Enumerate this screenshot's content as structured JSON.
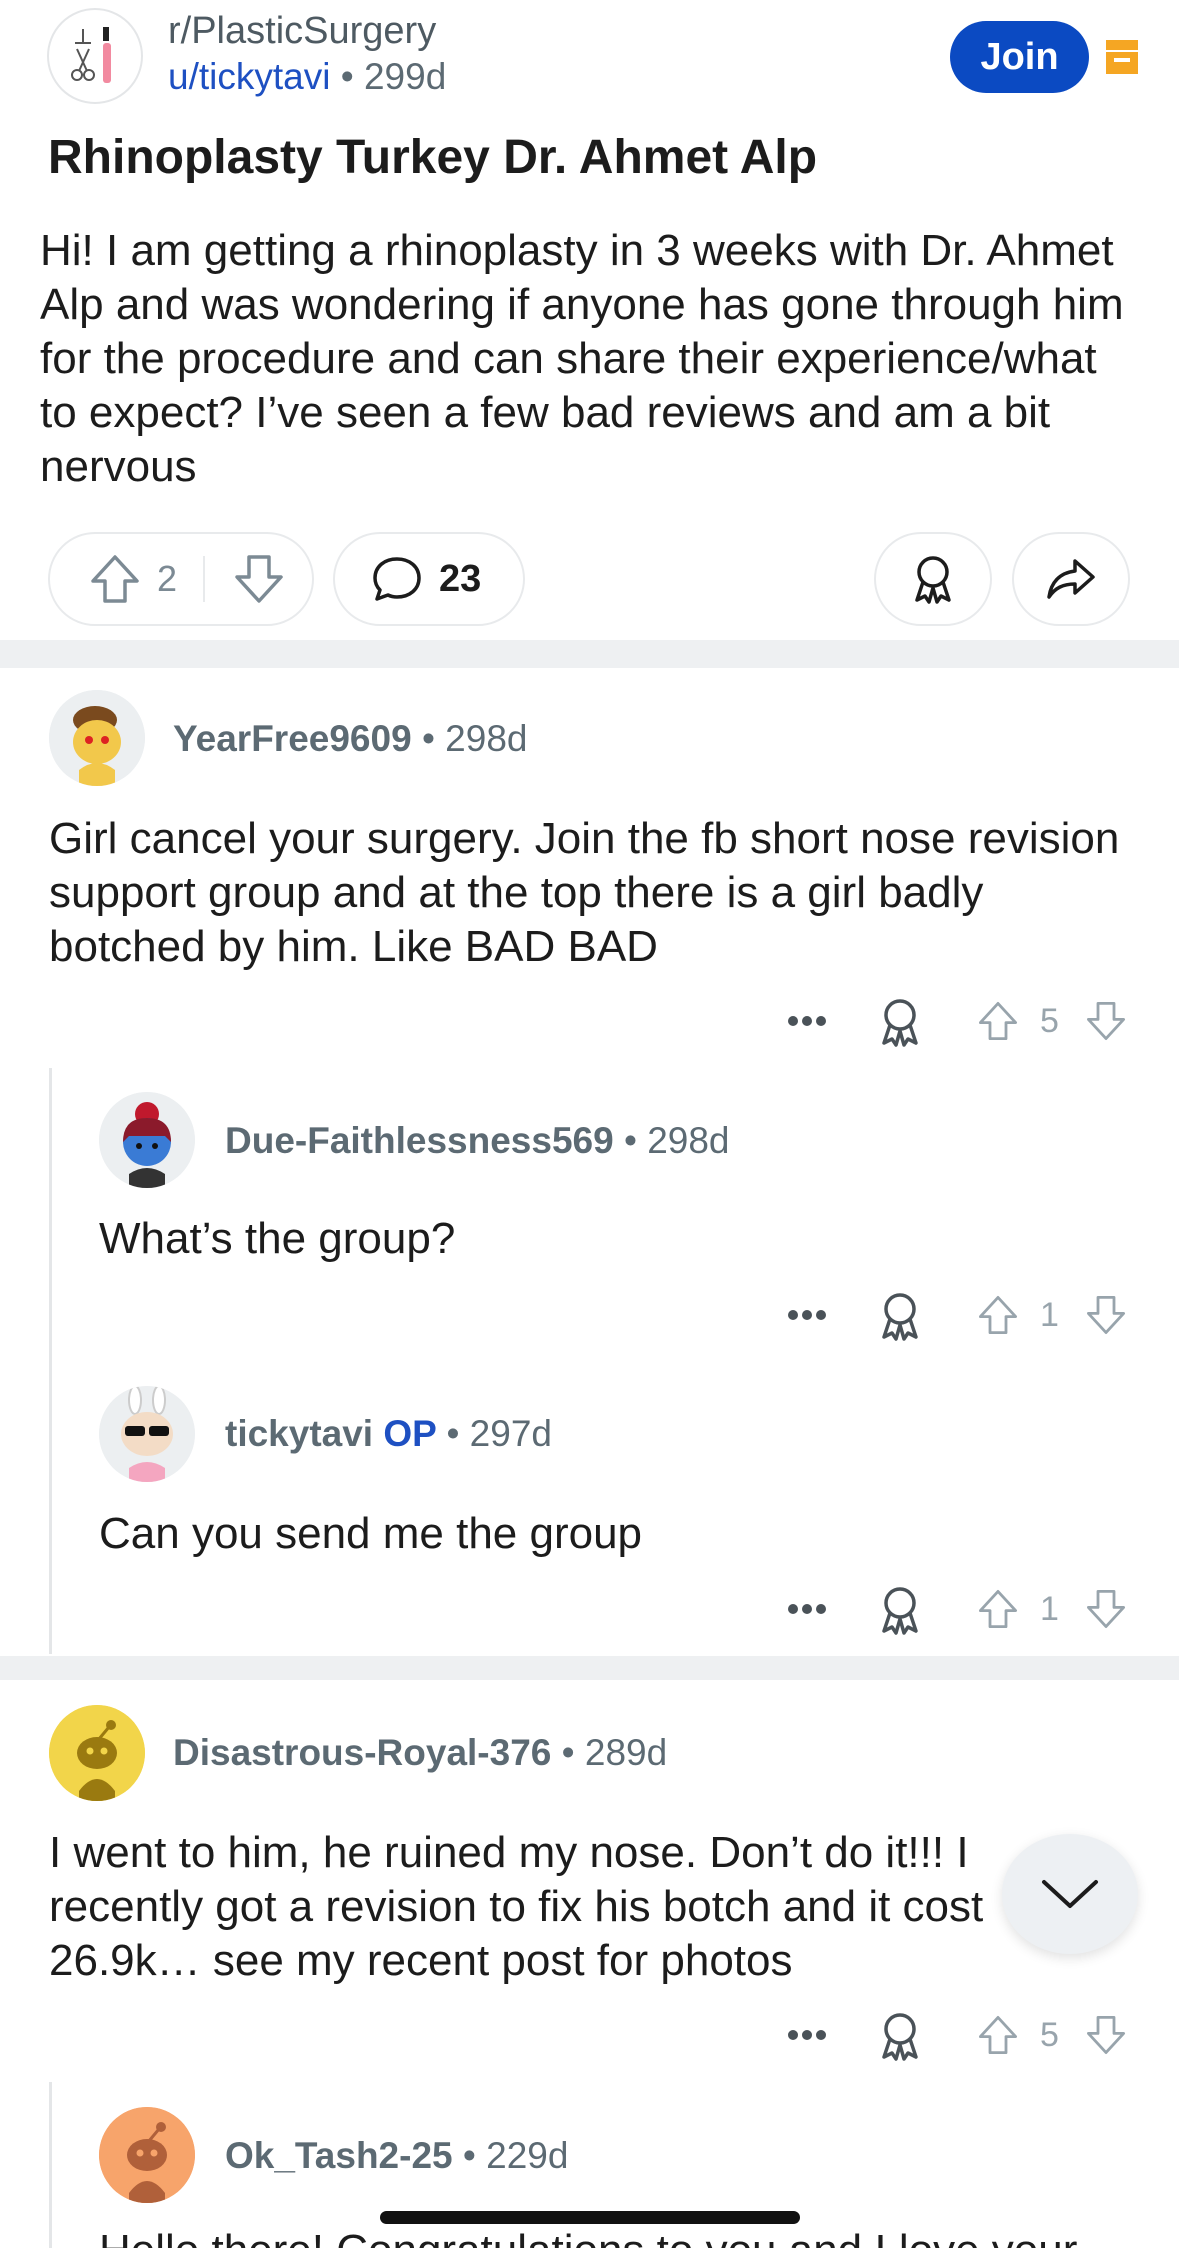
{
  "post": {
    "subreddit": "r/PlasticSurgery",
    "author": "u/tickytavi",
    "separator": "•",
    "age": "299d",
    "join_label": "Join",
    "title": "Rhinoplasty Turkey Dr. Ahmet Alp",
    "body": "Hi! I am getting a rhinoplasty in 3 weeks with Dr. Ahmet Alp and was wondering if anyone has gone through him for the procedure and can share their experience/what to expect? I’ve seen a few bad reviews and am a bit nervous",
    "upvotes": "2",
    "comments_count": "23"
  },
  "comments": [
    {
      "author": "YearFree9609",
      "age": "• 298d",
      "body": "Girl cancel your surgery. Join the fb short nose revision support group and at the top there is a girl badly botched by him. Like BAD BAD",
      "votes": "5"
    },
    {
      "author": "Due-Faithlessness569",
      "age": "• 298d",
      "body": "What’s the group?",
      "votes": "1"
    },
    {
      "author": "tickytavi",
      "op_badge": "OP",
      "age": "• 297d",
      "body": "Can you send me the group",
      "votes": "1"
    },
    {
      "author": "Disastrous-Royal-376",
      "age": "• 289d",
      "body": "I went to him, he ruined my nose. Don’t do it!!! I recently got a revision to fix his botch and it cost 26.9k… see my recent post for photos",
      "votes": "5"
    },
    {
      "author": "Ok_Tash2-25",
      "age": "• 229d",
      "body": "Hello there! Congratulations to you and I love your"
    }
  ],
  "colors": {
    "join_blue": "#0b4ac2",
    "link_blue": "#1e50c2",
    "meta_gray": "#5c6a73",
    "mod_yellow": "#f5a623"
  },
  "icons": [
    "upvote-icon",
    "downvote-icon",
    "comment-icon",
    "award-icon",
    "share-icon",
    "more-icon",
    "chevron-down-icon",
    "mod-icon"
  ]
}
